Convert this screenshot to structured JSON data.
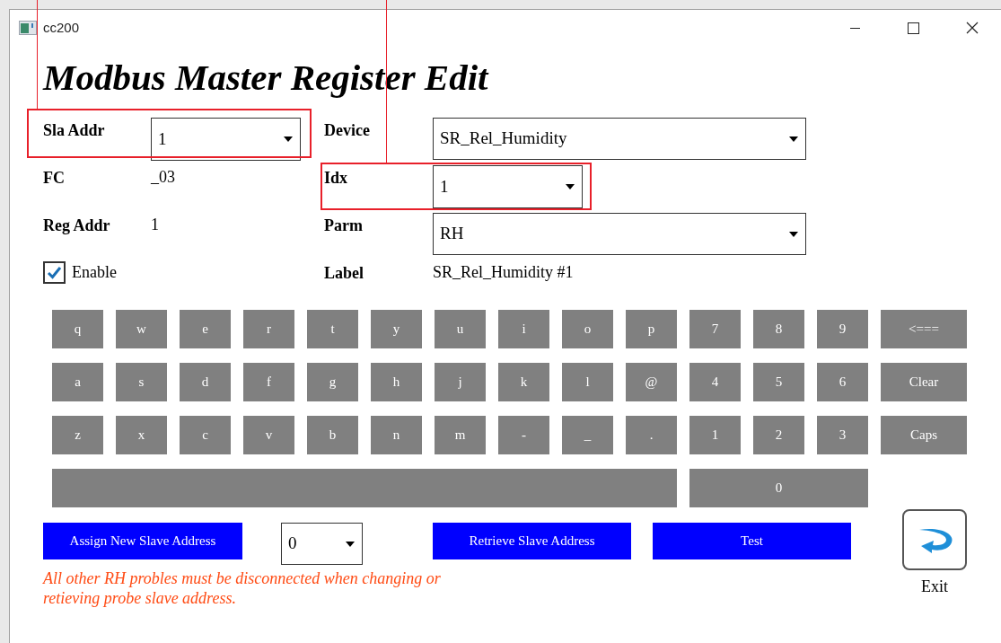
{
  "window": {
    "title": "cc200"
  },
  "heading": "Modbus Master Register Edit",
  "left_fields": [
    {
      "kind": "dropdown",
      "label": "Sla Addr",
      "value": "1",
      "highlighted": true
    },
    {
      "kind": "text",
      "label": "FC",
      "value": "_03",
      "highlighted": false
    },
    {
      "kind": "text",
      "label": "Reg Addr",
      "value": "1",
      "highlighted": false
    },
    {
      "kind": "checkbox",
      "label": "Enable",
      "checked": true,
      "highlighted": false
    }
  ],
  "right_fields": [
    {
      "kind": "wide_dropdown",
      "label": "Device",
      "value": "SR_Rel_Humidity",
      "highlighted": false
    },
    {
      "kind": "dropdown",
      "label": "Idx",
      "value": "1",
      "highlighted": true
    },
    {
      "kind": "wide_dropdown",
      "label": "Parm",
      "value": "RH",
      "highlighted": false
    },
    {
      "kind": "text",
      "label": "Label",
      "value": "SR_Rel_Humidity #1",
      "highlighted": false
    }
  ],
  "keyboard": {
    "rows": [
      [
        "q",
        "w",
        "e",
        "r",
        "t",
        "y",
        "u",
        "i",
        "o",
        "p",
        "7",
        "8",
        "9",
        "<==="
      ],
      [
        "a",
        "s",
        "d",
        "f",
        "g",
        "h",
        "j",
        "k",
        "l",
        "@",
        "4",
        "5",
        "6",
        "Clear"
      ],
      [
        "z",
        "x",
        "c",
        "v",
        "b",
        "n",
        "m",
        "-",
        "_",
        ".",
        "1",
        "2",
        "3",
        "Caps"
      ]
    ],
    "bottom_row": [
      {
        "kind": "space"
      },
      {
        "kind": "key",
        "label": "0"
      }
    ]
  },
  "assign_button": "Assign New Slave Address",
  "address_dropdown": {
    "value": "0"
  },
  "retrieve_button": "Retrieve Slave Address",
  "test_button": "Test",
  "exit_button": "Exit",
  "warning": "All other RH probles must be disconnected when changing or retieving probe slave address."
}
